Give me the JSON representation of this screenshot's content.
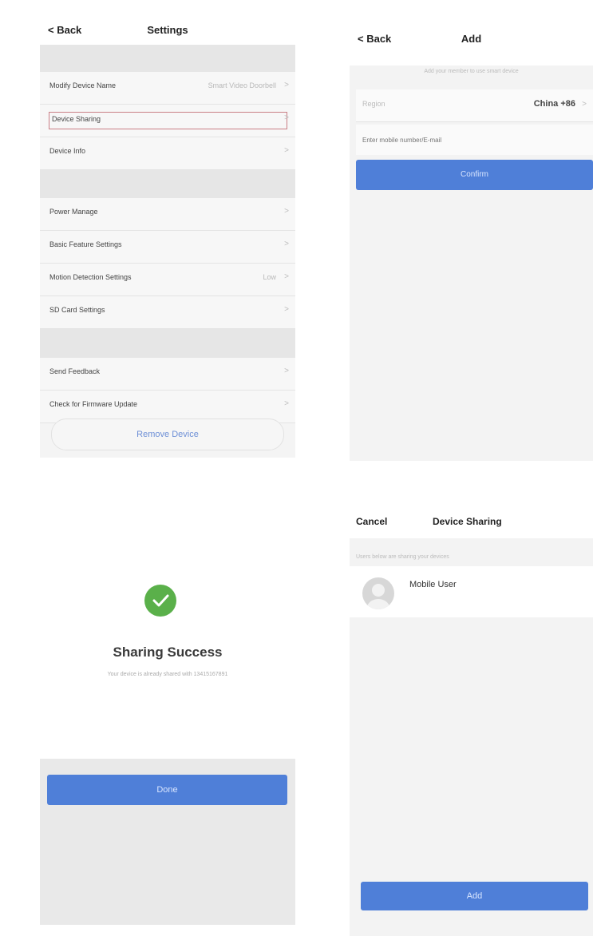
{
  "settings": {
    "back": "< Back",
    "title": "Settings",
    "rows": [
      {
        "label": "Modify Device Name",
        "value": "Smart Video Doorbell"
      },
      {
        "label": "Device Sharing",
        "value": ""
      },
      {
        "label": "Device Info",
        "value": ""
      },
      {
        "label": "Power Manage",
        "value": ""
      },
      {
        "label": "Basic Feature Settings",
        "value": ""
      },
      {
        "label": "Motion Detection Settings",
        "value": "Low"
      },
      {
        "label": "SD Card Settings",
        "value": ""
      },
      {
        "label": "Send Feedback",
        "value": ""
      },
      {
        "label": "Check for Firmware Update",
        "value": ""
      }
    ],
    "remove_button": "Remove Device"
  },
  "add": {
    "back": "< Back",
    "title": "Add",
    "hint": "Add your member to use smart device",
    "region_label": "Region",
    "region_value": "China +86",
    "phone_placeholder": "Enter mobile number/E-mail",
    "confirm_button": "Confirm"
  },
  "success": {
    "title": "Sharing Success",
    "message": "Your device is already shared with 13415167891",
    "done_button": "Done"
  },
  "sharing": {
    "cancel": "Cancel",
    "title": "Device Sharing",
    "hint": "Users below are sharing your devices",
    "user_name": "Mobile User",
    "add_button": "Add"
  },
  "colors": {
    "accent": "#4f7fd8",
    "success": "#5ab04a",
    "highlight_border": "#c97f86"
  }
}
